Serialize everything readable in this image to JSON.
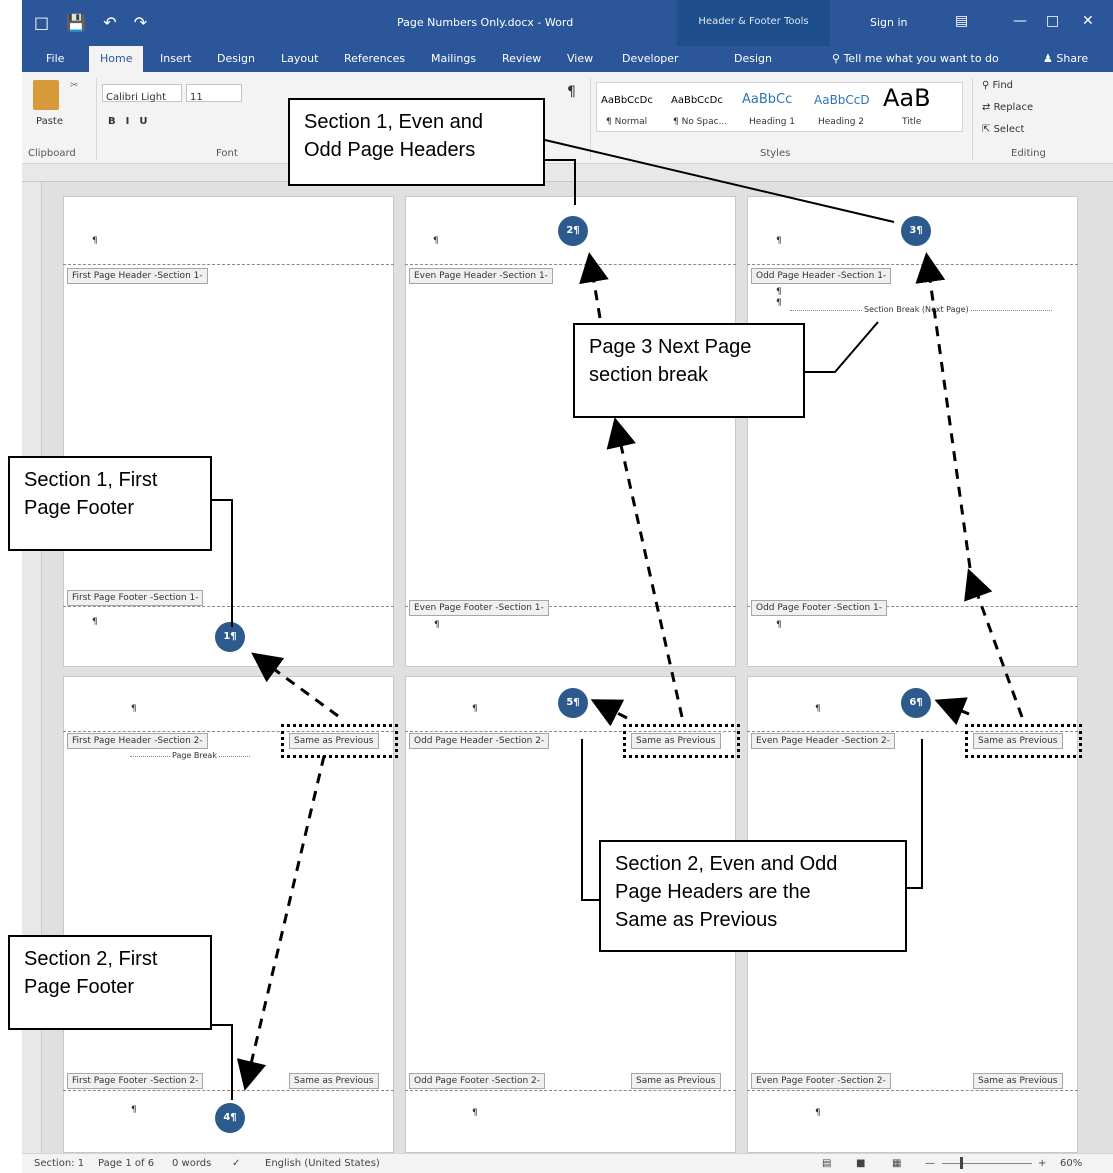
{
  "window": {
    "title": "Page Numbers Only.docx - Word",
    "context_tab_group": "Header & Footer Tools",
    "sign_in": "Sign in",
    "share": "Share"
  },
  "tabs": [
    "File",
    "Home",
    "Insert",
    "Design",
    "Layout",
    "References",
    "Mailings",
    "Review",
    "View",
    "Developer",
    "Design"
  ],
  "tell_me": "Tell me what you want to do",
  "ribbon": {
    "font_name": "Calibri Light",
    "font_size": "11",
    "paste": "Paste",
    "groups": {
      "clipboard": "Clipboard",
      "font": "Font",
      "styles": "Styles",
      "editing": "Editing"
    },
    "styles": [
      {
        "sample": "AaBbCcDc",
        "name": "¶ Normal"
      },
      {
        "sample": "AaBbCcDc",
        "name": "¶ No Spac..."
      },
      {
        "sample": "AaBbCc",
        "name": "Heading 1"
      },
      {
        "sample": "AaBbCcD",
        "name": "Heading 2"
      },
      {
        "sample": "AaB",
        "name": "Title"
      }
    ],
    "editing": {
      "find": "Find",
      "replace": "Replace",
      "select": "Select"
    }
  },
  "pages": {
    "p1": {
      "header": "First Page Header -Section 1-",
      "footer": "First Page Footer -Section 1-",
      "number": "1¶"
    },
    "p2": {
      "header": "Even Page Header -Section 1-",
      "footer": "Even Page Footer -Section 1-",
      "number": "2¶"
    },
    "p3": {
      "header": "Odd Page Header -Section 1-",
      "footer": "Odd Page Footer -Section 1-",
      "number": "3¶",
      "section_break": "Section Break (Next Page)"
    },
    "p4": {
      "header": "First Page Header -Section 2-",
      "footer": "First Page Footer -Section 2-",
      "number": "4¶",
      "page_break": "Page Break"
    },
    "p5": {
      "header": "Odd Page Header -Section 2-",
      "footer": "Odd Page Footer -Section 2-",
      "number": "5¶"
    },
    "p6": {
      "header": "Even Page Header -Section 2-",
      "footer": "Even Page Footer -Section 2-",
      "number": "6¶"
    },
    "same_as_previous": "Same as Previous",
    "pilcrow": "¶"
  },
  "callouts": {
    "c1": "Section 1, Even and\nOdd Page Headers",
    "c2": "Page 3 Next Page\nsection break",
    "c3": "Section 1, First\nPage Footer",
    "c4": "Section 2, Even and Odd\nPage Headers are the\nSame as Previous",
    "c5": "Section 2, First\nPage Footer"
  },
  "status": {
    "section": "Section: 1",
    "page": "Page 1 of 6",
    "words": "0 words",
    "language": "English (United States)",
    "zoom": "60%"
  }
}
